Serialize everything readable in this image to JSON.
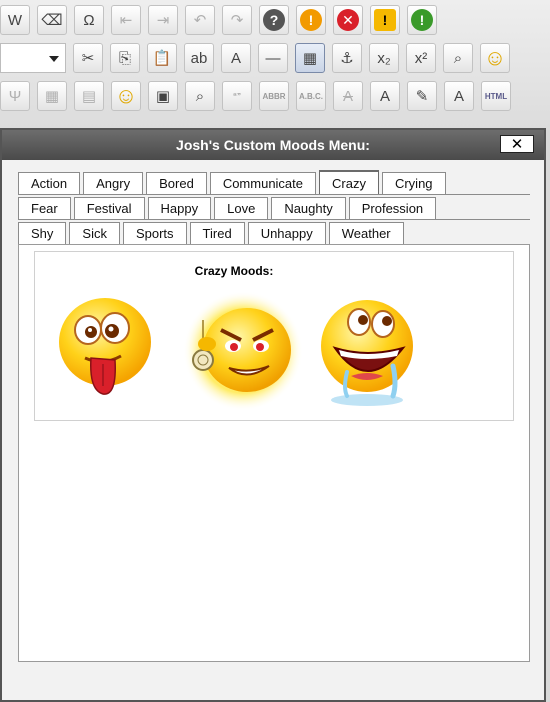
{
  "toolbar": {
    "row1": [
      {
        "name": "paste-word-icon",
        "glyph": "W"
      },
      {
        "name": "eraser-icon",
        "glyph": "⌫"
      },
      {
        "name": "omega-icon",
        "glyph": "Ω"
      },
      {
        "name": "outdent-icon",
        "glyph": "⇤"
      },
      {
        "name": "indent-icon",
        "glyph": "⇥"
      },
      {
        "name": "undo-icon",
        "glyph": "↶"
      },
      {
        "name": "redo-icon",
        "glyph": "↷"
      },
      {
        "name": "help-icon",
        "glyph": "?"
      },
      {
        "name": "orange-alert-icon",
        "glyph": "!"
      },
      {
        "name": "red-x-icon",
        "glyph": "✕"
      },
      {
        "name": "warning-icon",
        "glyph": "!"
      },
      {
        "name": "green-alert-icon",
        "glyph": "!"
      }
    ],
    "row2": [
      {
        "name": "cut-icon",
        "glyph": "✂"
      },
      {
        "name": "copy-icon",
        "glyph": "⎘"
      },
      {
        "name": "paste-icon",
        "glyph": "📋"
      },
      {
        "name": "spellcheck-icon",
        "glyph": "ab"
      },
      {
        "name": "font-icon",
        "glyph": "A"
      },
      {
        "name": "horizontal-rule-icon",
        "glyph": "—"
      },
      {
        "name": "table-icon",
        "glyph": "▦"
      },
      {
        "name": "anchor-icon",
        "glyph": "⚓"
      },
      {
        "name": "subscript-icon",
        "glyph": "x₂"
      },
      {
        "name": "superscript-icon",
        "glyph": "x²"
      },
      {
        "name": "find-icon",
        "glyph": "⌕"
      },
      {
        "name": "smiley-icon",
        "glyph": "☺"
      }
    ],
    "row3": [
      {
        "name": "cleanup-icon",
        "glyph": "Ψ"
      },
      {
        "name": "table-props-icon",
        "glyph": "▦"
      },
      {
        "name": "cell-props-icon",
        "glyph": "▤"
      },
      {
        "name": "emoticon-icon",
        "glyph": "☺"
      },
      {
        "name": "image-icon",
        "glyph": "▣"
      },
      {
        "name": "preview-icon",
        "glyph": "⌕"
      },
      {
        "name": "quote-icon",
        "glyph": "“”"
      },
      {
        "name": "abbr-icon",
        "glyph": "ABBR"
      },
      {
        "name": "acronym-icon",
        "glyph": "A.B.C."
      },
      {
        "name": "strike-icon",
        "glyph": "A"
      },
      {
        "name": "text-color-icon",
        "glyph": "A"
      },
      {
        "name": "edit-icon",
        "glyph": "✎"
      },
      {
        "name": "style-icon",
        "glyph": "A"
      },
      {
        "name": "html-icon",
        "glyph": "HTML"
      }
    ]
  },
  "dialog": {
    "title": "Josh's Custom Moods Menu:",
    "close_label": "✕",
    "tabs_row1": [
      "Action",
      "Angry",
      "Bored",
      "Communicate",
      "Crazy",
      "Crying"
    ],
    "tabs_row2": [
      "Fear",
      "Festival",
      "Happy",
      "Love",
      "Naughty",
      "Profession"
    ],
    "tabs_row3": [
      "Shy",
      "Sick",
      "Sports",
      "Tired",
      "Unhappy",
      "Weather"
    ],
    "active_tab": "Crazy",
    "mood_heading": "Crazy Moods:",
    "emoticons": [
      "tongue-out-emoticon",
      "evil-hypnotist-emoticon",
      "drooling-emoticon"
    ]
  },
  "colors": {
    "titlebar": "#555555",
    "emoticon_yellow": "#ffd21a",
    "emoticon_orange": "#f5a300",
    "tongue_red": "#d9202a"
  }
}
